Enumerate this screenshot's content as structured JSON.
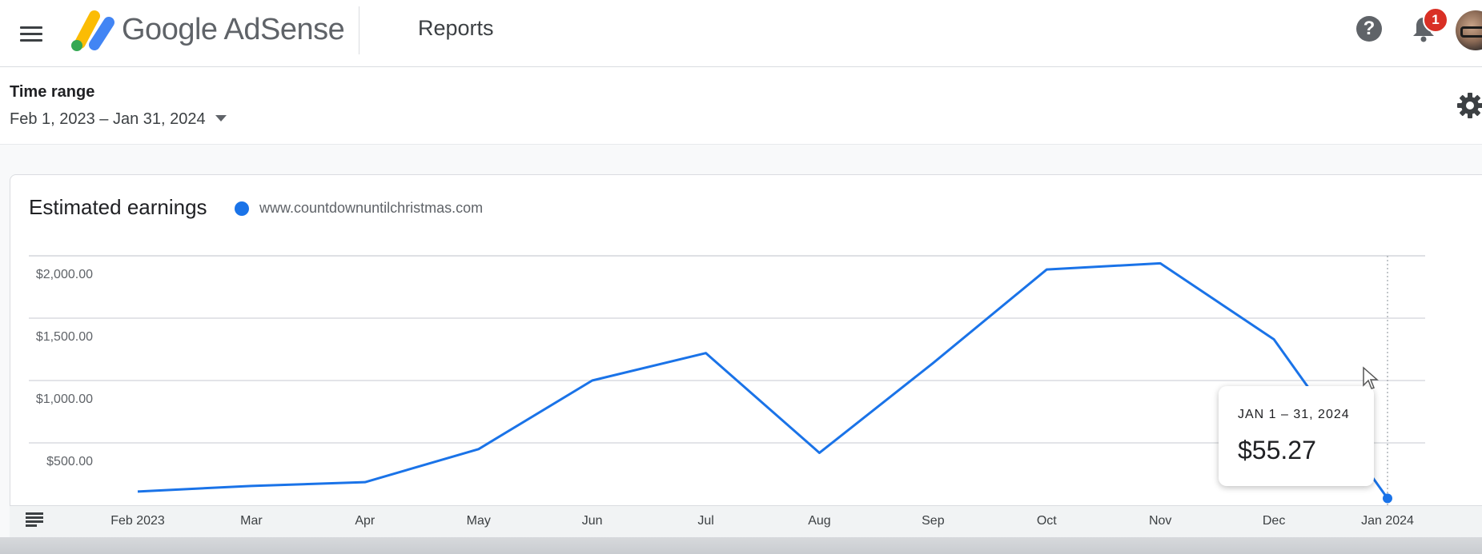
{
  "header": {
    "menu_icon": "hamburger-menu-icon",
    "brand": "Google AdSense",
    "page_title": "Reports",
    "help_icon": "help-icon",
    "notifications_icon": "bell-icon",
    "notification_count": "1"
  },
  "filters": {
    "time_range_label": "Time range",
    "time_range_value": "Feb 1, 2023 – Jan 31, 2024"
  },
  "card": {
    "title": "Estimated earnings",
    "legend_site": "www.countdownuntilchristmas.com"
  },
  "tooltip": {
    "date": "JAN 1 – 31, 2024",
    "value": "$55.27"
  },
  "colors": {
    "series": "#1a73e8",
    "brand_yellow": "#fbbc04",
    "brand_blue": "#4285f4",
    "brand_green": "#34a853"
  },
  "chart_data": {
    "type": "line",
    "title": "Estimated earnings",
    "categories": [
      "Feb 2023",
      "Mar",
      "Apr",
      "May",
      "Jun",
      "Jul",
      "Aug",
      "Sep",
      "Oct",
      "Nov",
      "Dec",
      "Jan 2024"
    ],
    "y_ticks": [
      "$500.00",
      "$1,000.00",
      "$1,500.00",
      "$2,000.00"
    ],
    "y_tick_values": [
      500,
      1000,
      1500,
      2000
    ],
    "ylim": [
      0,
      2000
    ],
    "grid": true,
    "legend": "top-left",
    "series": [
      {
        "name": "www.countdownuntilchristmas.com",
        "values": [
          110,
          155,
          185,
          450,
          1000,
          1220,
          420,
          1140,
          1890,
          1940,
          1330,
          55.27
        ]
      }
    ],
    "highlighted_index": 11
  }
}
